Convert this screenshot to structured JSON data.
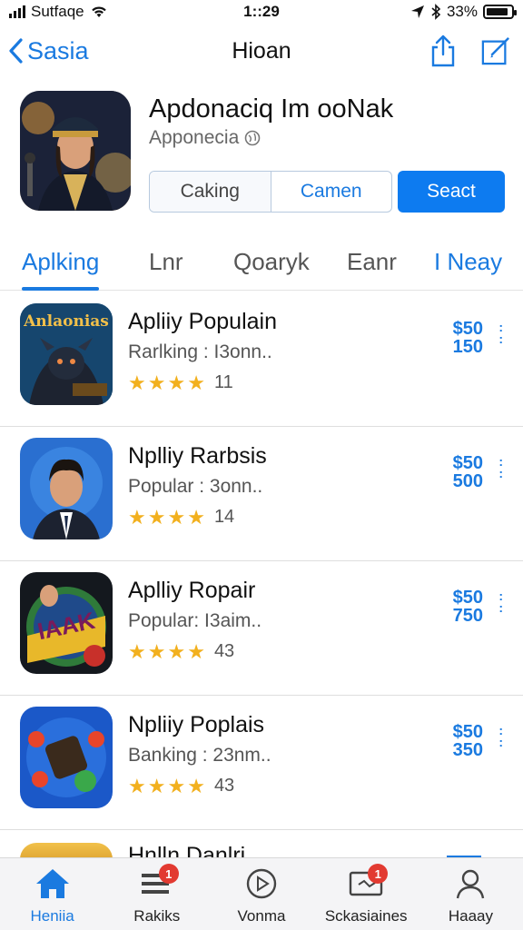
{
  "status_bar": {
    "carrier": "Sutfaqe",
    "time": "1::29",
    "battery": "33%"
  },
  "nav": {
    "back_label": "Sasia",
    "title": "Hioan",
    "icons": [
      "share-icon",
      "compose-icon"
    ]
  },
  "app": {
    "name": "Apdonaciq Im ooNak",
    "developer": "Apponecia",
    "segment": [
      "Caking",
      "Camen"
    ],
    "primary_button": "Seact"
  },
  "tabs": [
    {
      "label": "Aplking",
      "active": true
    },
    {
      "label": "Lnr",
      "active": false
    },
    {
      "label": "Qoaryk",
      "active": false
    },
    {
      "label": "Eanr",
      "active": false
    },
    {
      "label": "I Neay",
      "active": false
    }
  ],
  "list": [
    {
      "title": "Apliiy Populain",
      "subtitle": "Rarlking : I3onn..",
      "rating": 4.5,
      "count": "11",
      "price_top": "$50",
      "price_bottom": "150",
      "icon_text": "Anlaonias"
    },
    {
      "title": "Nplliy Rarbsis",
      "subtitle": "Popular : 3onn..",
      "rating": 4,
      "count": "14",
      "price_top": "$50",
      "price_bottom": "500",
      "icon_text": ""
    },
    {
      "title": "Aplliy Ropair",
      "subtitle": "Popular: I3aim..",
      "rating": 4.5,
      "count": "43",
      "price_top": "$50",
      "price_bottom": "750",
      "icon_text": "IAAK"
    },
    {
      "title": "Npliiy Poplais",
      "subtitle": "Banking : 23nm..",
      "rating": 4.5,
      "count": "43",
      "price_top": "$50",
      "price_bottom": "350",
      "icon_text": ""
    }
  ],
  "partial_row": {
    "title": "Hnlln Danlri"
  },
  "tabbar": [
    {
      "label": "Heniia",
      "icon": "home-icon",
      "active": true,
      "badge": ""
    },
    {
      "label": "Rakiks",
      "icon": "list-icon",
      "active": false,
      "badge": "1"
    },
    {
      "label": "Vonma",
      "icon": "play-icon",
      "active": false,
      "badge": ""
    },
    {
      "label": "Sckasiaines",
      "icon": "screen-icon",
      "active": false,
      "badge": "1"
    },
    {
      "label": "Haaay",
      "icon": "person-icon",
      "active": false,
      "badge": ""
    }
  ],
  "colors": {
    "accent": "#1a7ae0",
    "button": "#0d7bf0",
    "star": "#f2b01e",
    "badge": "#e23a31"
  }
}
